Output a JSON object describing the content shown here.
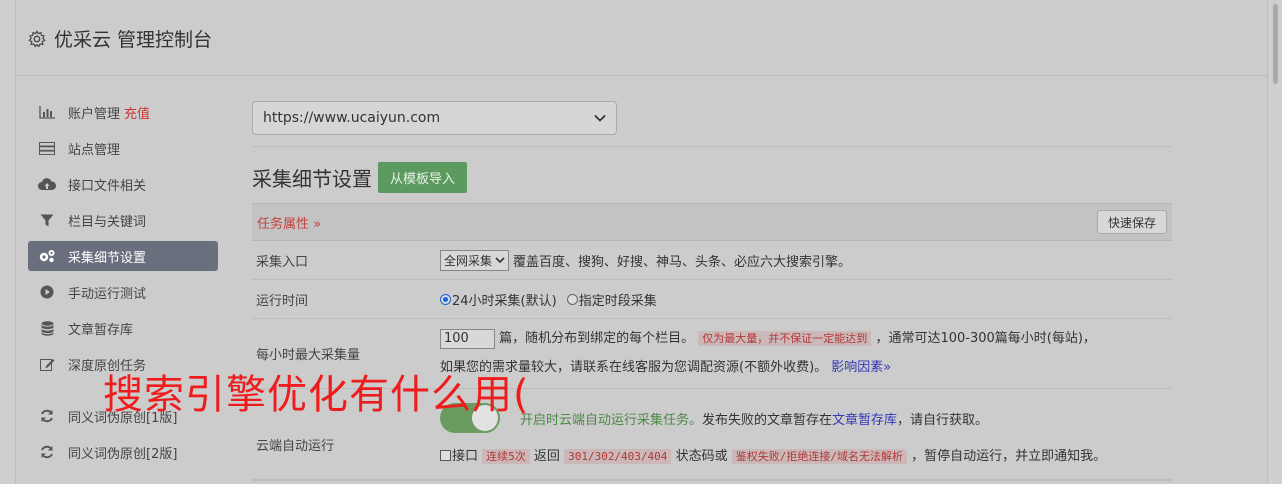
{
  "header": {
    "title": "优采云 管理控制台"
  },
  "sidebar": {
    "items": [
      {
        "label": "账户管理",
        "extra": "充值",
        "icon": "bar-chart-icon"
      },
      {
        "label": "站点管理",
        "icon": "server-icon"
      },
      {
        "label": "接口文件相关",
        "icon": "cloud-upload-icon"
      },
      {
        "label": "栏目与关键词",
        "icon": "filter-icon"
      },
      {
        "label": "采集细节设置",
        "icon": "gears-icon",
        "active": true
      },
      {
        "label": "手动运行测试",
        "icon": "play-circle-icon"
      },
      {
        "label": "文章暂存库",
        "icon": "database-icon"
      },
      {
        "label": "深度原创任务",
        "icon": "edit-icon"
      }
    ],
    "items2": [
      {
        "label": "同义词伪原创[1版]",
        "icon": "refresh-icon"
      },
      {
        "label": "同义词伪原创[2版]",
        "icon": "refresh-icon"
      }
    ]
  },
  "main": {
    "site_select": "https://www.ucaiyun.com",
    "section_title": "采集细节设置",
    "import_button": "从模板导入",
    "props_label": "任务属性 »",
    "quick_save": "快速保存",
    "rows": {
      "entry": {
        "label": "采集入口",
        "select": "全网采集",
        "desc": "覆盖百度、搜狗、好搜、神马、头条、必应六大搜索引擎。"
      },
      "runtime": {
        "label": "运行时间",
        "opt1": "24小时采集(默认)",
        "opt2": "指定时段采集"
      },
      "max": {
        "label": "每小时最大采集量",
        "value": "100",
        "text1": "篇，随机分布到绑定的每个栏目。",
        "pill": "仅为最大量，并不保证一定能达到",
        "text2": "，通常可达100-300篇每小时(每站)，",
        "line2": "如果您的需求量较大，请联系在线客服为您调配资源(不额外收费)。",
        "link": "影响因素»"
      },
      "cloud": {
        "label": "云端自动运行",
        "green": "开启时云端自动运行采集任务。",
        "text": "发布失败的文章暂存在",
        "link": "文章暂存库",
        "text2": "，请自行获取。",
        "check_label": "接口",
        "pill1": "连续5次",
        "mid1": "返回",
        "pill2": "301/302/403/404",
        "mid2": "状态码或",
        "pill3": "鉴权失败/拒绝连接/域名无法解析",
        "tail": "，暂停自动运行，并立即通知我。"
      }
    }
  },
  "overlay": {
    "text": "搜索引擎优化有什么用("
  }
}
